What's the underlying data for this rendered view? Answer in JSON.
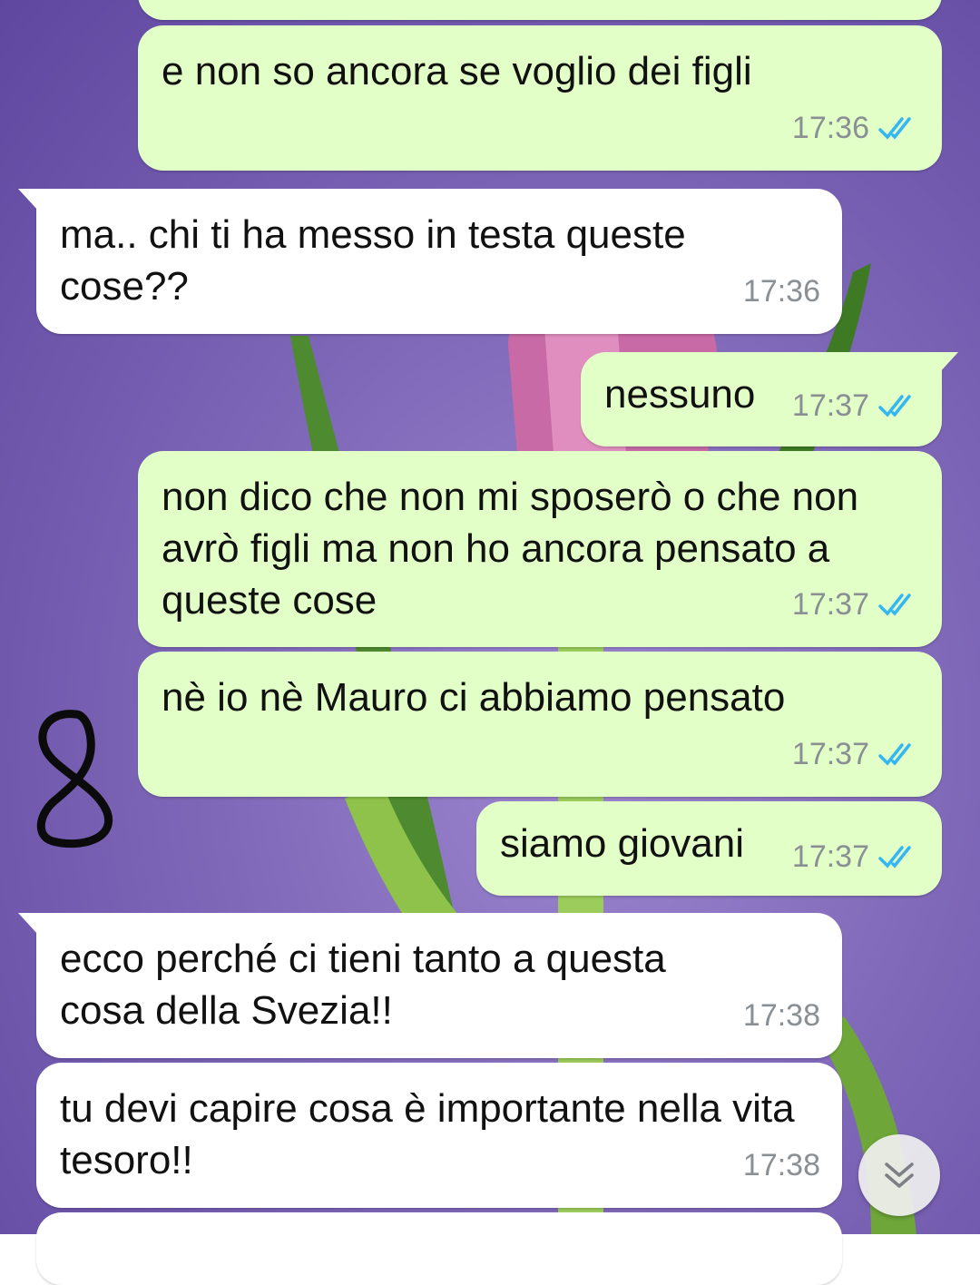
{
  "messages": [
    {
      "direction": "out",
      "text": "",
      "time": ""
    },
    {
      "direction": "out",
      "text": "e non so ancora se voglio dei figli",
      "time": "17:36"
    },
    {
      "direction": "in",
      "text": "ma.. chi ti ha messo in testa queste cose??",
      "time": "17:36"
    },
    {
      "direction": "out",
      "text": "nessuno",
      "time": "17:37"
    },
    {
      "direction": "out",
      "text": "non dico che non mi sposerò o che non avrò figli ma non ho ancora pensato a queste cose",
      "time": "17:37"
    },
    {
      "direction": "out",
      "text": "nè io nè Mauro ci abbiamo pensato",
      "time": "17:37"
    },
    {
      "direction": "out",
      "text": "siamo giovani",
      "time": "17:37"
    },
    {
      "direction": "in",
      "text": "ecco perché ci tieni tanto a questa cosa della Svezia!!",
      "time": "17:38"
    },
    {
      "direction": "in",
      "text": "tu devi capire cosa è importante nella vita tesoro!!",
      "time": "17:38"
    },
    {
      "direction": "in",
      "text": "",
      "time": ""
    }
  ],
  "colors": {
    "outgoing_bubble": "#e2ffc8",
    "incoming_bubble": "#ffffff",
    "read_ticks": "#34b7f1",
    "timestamp": "#8a8f94"
  },
  "icons": {
    "read_receipt": "double-check-icon",
    "scroll_down": "chevron-double-down-icon",
    "doodle": "number-eight-handwritten"
  }
}
